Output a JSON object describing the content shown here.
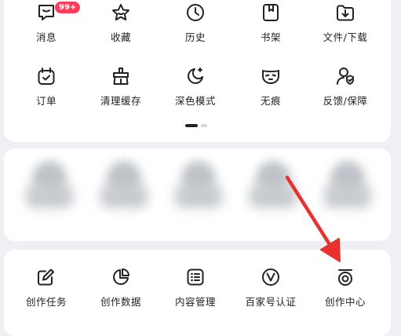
{
  "row1": [
    {
      "label": "消息",
      "icon": "message-icon",
      "badge": "99+"
    },
    {
      "label": "收藏",
      "icon": "star-icon"
    },
    {
      "label": "历史",
      "icon": "clock-icon"
    },
    {
      "label": "书架",
      "icon": "bookshelf-icon"
    },
    {
      "label": "文件/下载",
      "icon": "download-folder-icon"
    }
  ],
  "row2": [
    {
      "label": "订单",
      "icon": "order-icon"
    },
    {
      "label": "清理缓存",
      "icon": "clean-cache-icon"
    },
    {
      "label": "深色模式",
      "icon": "moon-icon"
    },
    {
      "label": "无痕",
      "icon": "mask-icon"
    },
    {
      "label": "反馈/保障",
      "icon": "feedback-shield-icon"
    }
  ],
  "row3": [
    {
      "label": "创作任务",
      "icon": "edit-task-icon"
    },
    {
      "label": "创作数据",
      "icon": "pie-chart-icon"
    },
    {
      "label": "内容管理",
      "icon": "list-icon"
    },
    {
      "label": "百家号认证",
      "icon": "verified-v-icon"
    },
    {
      "label": "创作中心",
      "icon": "creator-center-icon"
    }
  ],
  "colors": {
    "badge": "#ff3b5c",
    "arrow": "#e8322f",
    "background": "#eef0f4",
    "card": "#ffffff"
  }
}
